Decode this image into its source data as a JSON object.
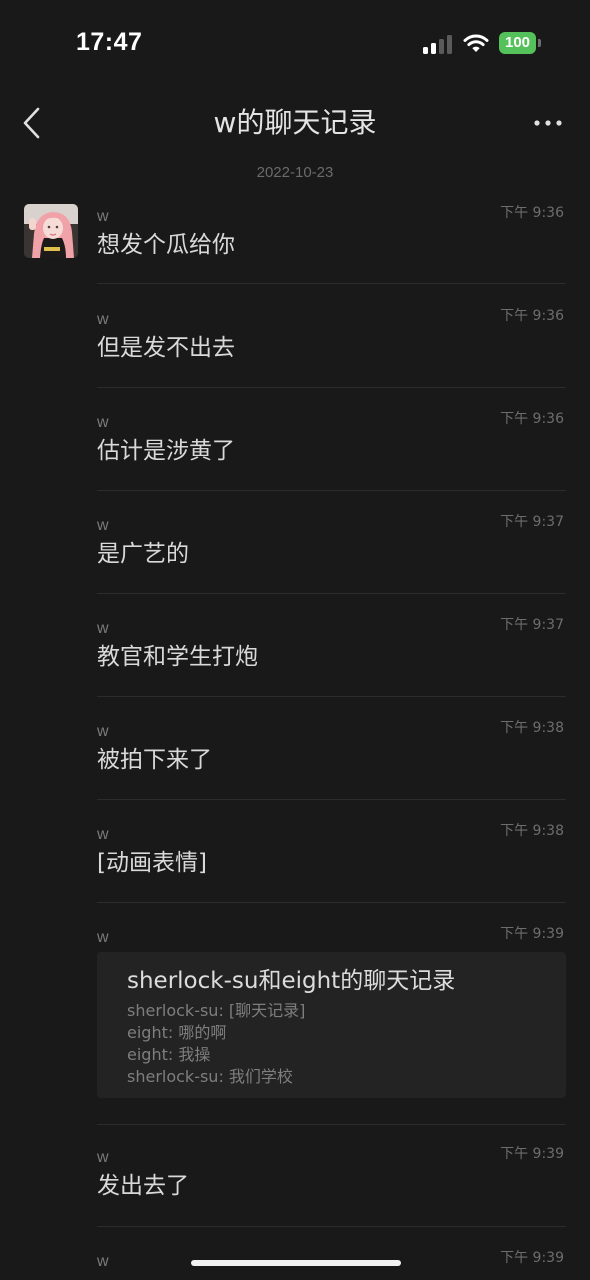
{
  "status_bar": {
    "time": "17:47",
    "battery": "100",
    "battery_color": "#55c15a",
    "icons": [
      "signal-icon",
      "wifi-icon",
      "battery-icon"
    ]
  },
  "nav": {
    "title": "w的聊天记录",
    "back_icon": "chevron-left-icon",
    "more_icon": "more-horizontal-icon"
  },
  "date_header": "2022-10-23",
  "messages": [
    {
      "sender": "w",
      "time": "下午 9:36",
      "text": "想发个瓜给你"
    },
    {
      "sender": "w",
      "time": "下午 9:36",
      "text": "但是发不出去"
    },
    {
      "sender": "w",
      "time": "下午 9:36",
      "text": "估计是涉黄了"
    },
    {
      "sender": "w",
      "time": "下午 9:37",
      "text": "是广艺的"
    },
    {
      "sender": "w",
      "time": "下午 9:37",
      "text": "教官和学生打炮"
    },
    {
      "sender": "w",
      "time": "下午 9:38",
      "text": "被拍下来了"
    },
    {
      "sender": "w",
      "time": "下午 9:38",
      "text": "[动画表情]"
    },
    {
      "sender": "w",
      "time": "下午 9:39",
      "record": {
        "title": "sherlock-su和eight的聊天记录",
        "lines": [
          "sherlock-su: [聊天记录]",
          "eight: 哪的啊",
          "eight: 我操",
          "sherlock-su: 我们学校"
        ]
      }
    },
    {
      "sender": "w",
      "time": "下午 9:39",
      "text": "发出去了"
    },
    {
      "sender": "w",
      "time": "下午 9:39"
    }
  ]
}
